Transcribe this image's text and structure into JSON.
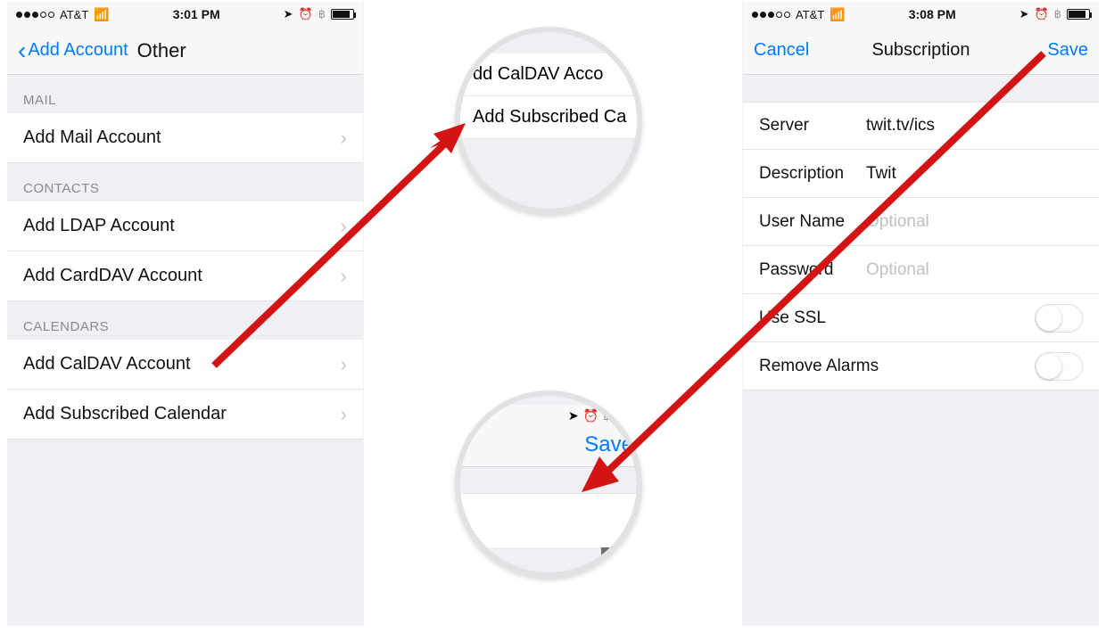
{
  "left_phone": {
    "status": {
      "carrier": "AT&T",
      "time": "3:01 PM"
    },
    "nav": {
      "back_label": "Add Account",
      "title": "Other"
    },
    "sections": {
      "mail": {
        "header": "MAIL",
        "items": [
          "Add Mail Account"
        ]
      },
      "contacts": {
        "header": "CONTACTS",
        "items": [
          "Add LDAP Account",
          "Add CardDAV Account"
        ]
      },
      "calendars": {
        "header": "CALENDARS",
        "items": [
          "Add CalDAV Account",
          "Add Subscribed Calendar"
        ]
      }
    }
  },
  "right_phone": {
    "status": {
      "carrier": "AT&T",
      "time": "3:08 PM"
    },
    "nav": {
      "cancel": "Cancel",
      "title": "Subscription",
      "save": "Save"
    },
    "form": {
      "server": {
        "label": "Server",
        "value": "twit.tv/ics"
      },
      "description": {
        "label": "Description",
        "value": "Twit"
      },
      "username": {
        "label": "User Name",
        "placeholder": "Optional"
      },
      "password": {
        "label": "Password",
        "placeholder": "Optional"
      },
      "use_ssl": {
        "label": "Use SSL"
      },
      "remove_alarms": {
        "label": "Remove Alarms"
      }
    }
  },
  "zoom_top": {
    "row1": "dd CalDAV Acco",
    "row2": "Add Subscribed Ca"
  },
  "zoom_bottom": {
    "save": "Save"
  }
}
